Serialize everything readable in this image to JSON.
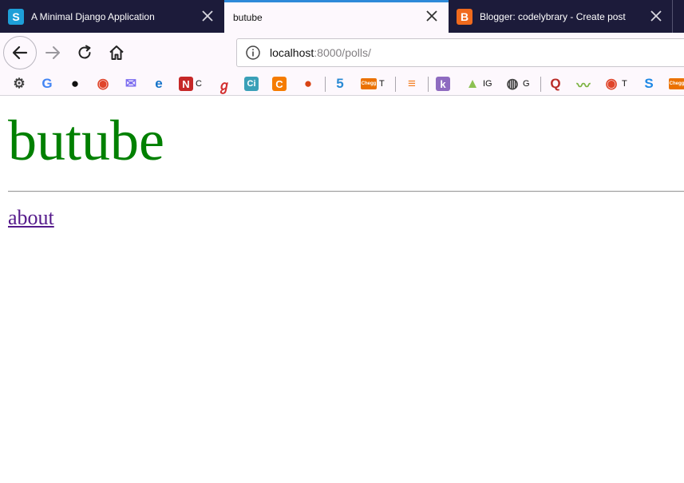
{
  "colors": {
    "tabstrip_bg": "#1c1b3a",
    "active_tab_accent": "#2e8ad9",
    "title_green": "#008000",
    "visited_link": "#551a8b"
  },
  "tabs": [
    {
      "title": "A Minimal Django Application",
      "favicon": "S",
      "favicon_icon": "squarespace-s-icon",
      "favicon_color": "#1e9fd8",
      "active": false
    },
    {
      "title": "butube",
      "favicon": "",
      "active": true
    },
    {
      "title": "Blogger: codelybrary - Create post",
      "favicon": "B",
      "favicon_icon": "blogger-icon",
      "favicon_color": "#f06a1d",
      "active": false
    }
  ],
  "toolbar": {
    "url_host": "localhost",
    "url_rest": ":8000/polls/"
  },
  "bookmarks": [
    {
      "icon": "gear-icon",
      "glyph": "⚙",
      "color": "#444444",
      "label": ""
    },
    {
      "icon": "google-icon",
      "glyph": "G",
      "color": "#4285f4",
      "label": ""
    },
    {
      "icon": "github-icon",
      "glyph": "●",
      "color": "#111111",
      "label": ""
    },
    {
      "icon": "ring-icon",
      "glyph": "◉",
      "color": "#e0452a",
      "label": ""
    },
    {
      "icon": "mail-icon",
      "glyph": "✉",
      "color": "#7b6cf0",
      "label": ""
    },
    {
      "icon": "edge-icon",
      "glyph": "e",
      "color": "#1473c9",
      "label": ""
    },
    {
      "icon": "n-icon",
      "glyph": "N",
      "color": "#c62828",
      "label": "C"
    },
    {
      "icon": "swirl-icon",
      "glyph": "ℊ",
      "color": "#d32f2f",
      "label": ""
    },
    {
      "icon": "ci-icon",
      "glyph": "Ci",
      "color": "#3aa0b8",
      "label": ""
    },
    {
      "icon": "c-icon",
      "glyph": "C",
      "color": "#f57c00",
      "label": ""
    },
    {
      "icon": "orb-icon",
      "glyph": "●",
      "color": "#d84315",
      "label": ""
    },
    {
      "icon": "five-icon",
      "glyph": "5",
      "color": "#2a8ad4",
      "label": ""
    },
    {
      "icon": "chegg-icon",
      "glyph": "Chegg",
      "color": "#eb7100",
      "label": "T"
    },
    {
      "icon": "stackoverflow-icon",
      "glyph": "≡",
      "color": "#f48024",
      "label": ""
    },
    {
      "icon": "k-icon",
      "glyph": "k",
      "color": "#8e6bc0",
      "label": ""
    },
    {
      "icon": "android-icon",
      "glyph": "▲",
      "color": "#8cc152",
      "label": "IG"
    },
    {
      "icon": "globe-icon",
      "glyph": "◍",
      "color": "#444444",
      "label": "G"
    },
    {
      "icon": "quora-icon",
      "glyph": "Q",
      "color": "#b92b27",
      "label": ""
    },
    {
      "icon": "trend-icon",
      "glyph": "〰",
      "color": "#7cb342",
      "label": ""
    },
    {
      "icon": "ring-icon",
      "glyph": "◉",
      "color": "#e0452a",
      "label": "T"
    },
    {
      "icon": "s-icon",
      "glyph": "S",
      "color": "#1e88e5",
      "label": ""
    },
    {
      "icon": "chegg-icon",
      "glyph": "Chegg",
      "color": "#eb7100",
      "label": ""
    }
  ],
  "page": {
    "title": "butube",
    "about_link": "about"
  }
}
